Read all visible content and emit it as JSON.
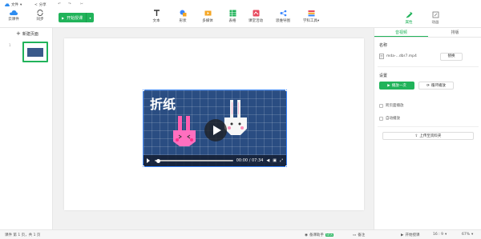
{
  "menubar": {
    "file_label": "文件",
    "share_label": "分享"
  },
  "left_buttons": [
    {
      "label": "云课件",
      "icon": "cloud-icon"
    },
    {
      "label": "同步",
      "icon": "sync-icon"
    }
  ],
  "start_button": {
    "label": "开始授课",
    "icon": "play-icon"
  },
  "tools": [
    {
      "label": "文本",
      "icon": "text-icon"
    },
    {
      "label": "形状",
      "icon": "shape-icon"
    },
    {
      "label": "多媒体",
      "icon": "media-icon"
    },
    {
      "label": "表格",
      "icon": "table-icon"
    },
    {
      "label": "课堂活动",
      "icon": "activity-icon"
    },
    {
      "label": "思维导图",
      "icon": "mindmap-icon"
    },
    {
      "label": "学科工具",
      "icon": "subject-tools-icon"
    }
  ],
  "right_tabs": [
    {
      "label": "属性",
      "icon": "property-icon",
      "active": true
    },
    {
      "label": "动画",
      "icon": "animation-icon",
      "active": false
    }
  ],
  "left_panel": {
    "new_page_label": "新建页面",
    "slide_number": "1"
  },
  "video": {
    "overlay_text": "折纸",
    "time": "00:00 / 07:34"
  },
  "properties": {
    "tabs": [
      {
        "label": "音视频",
        "active": true
      },
      {
        "label": "排版",
        "active": false
      }
    ],
    "name_label": "名称",
    "file_name": "mda-...dbr7.mp4",
    "replace_label": "替换",
    "settings_label": "设置",
    "play_once_label": "播放一次",
    "loop_label": "循环播放",
    "cross_page_label": "跨页面播放",
    "autoplay_label": "自动播放",
    "upload_label": "上传至资料夹"
  },
  "statusbar": {
    "page_info": "课件 第 1 页，共 1 页",
    "assistant_label": "备课助手",
    "new_badge": "NEW",
    "notes_label": "备注",
    "start_label": "开始授课",
    "ratio": "16 : 9",
    "zoom": "67%"
  },
  "colors": {
    "accent": "#21b35a",
    "selection": "#3a86ff"
  }
}
